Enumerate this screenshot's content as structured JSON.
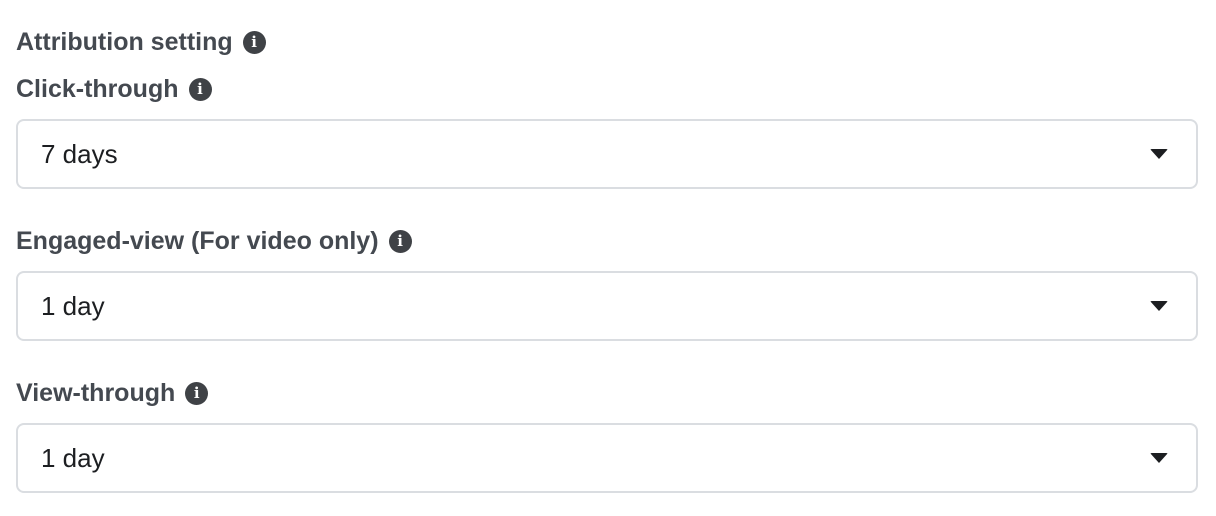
{
  "attribution": {
    "title": "Attribution setting",
    "info_icon": "info-icon"
  },
  "fields": [
    {
      "label": "Click-through",
      "value": "7 days",
      "info_icon": "info-icon",
      "dropdown_icon": "chevron-down-icon"
    },
    {
      "label": "Engaged-view (For video only)",
      "value": "1 day",
      "info_icon": "info-icon",
      "dropdown_icon": "chevron-down-icon"
    },
    {
      "label": "View-through",
      "value": "1 day",
      "info_icon": "info-icon",
      "dropdown_icon": "chevron-down-icon"
    }
  ],
  "colors": {
    "label_text": "#444950",
    "value_text": "#1c1e21",
    "border": "#dadde1",
    "icon_bg": "#3f4246"
  }
}
